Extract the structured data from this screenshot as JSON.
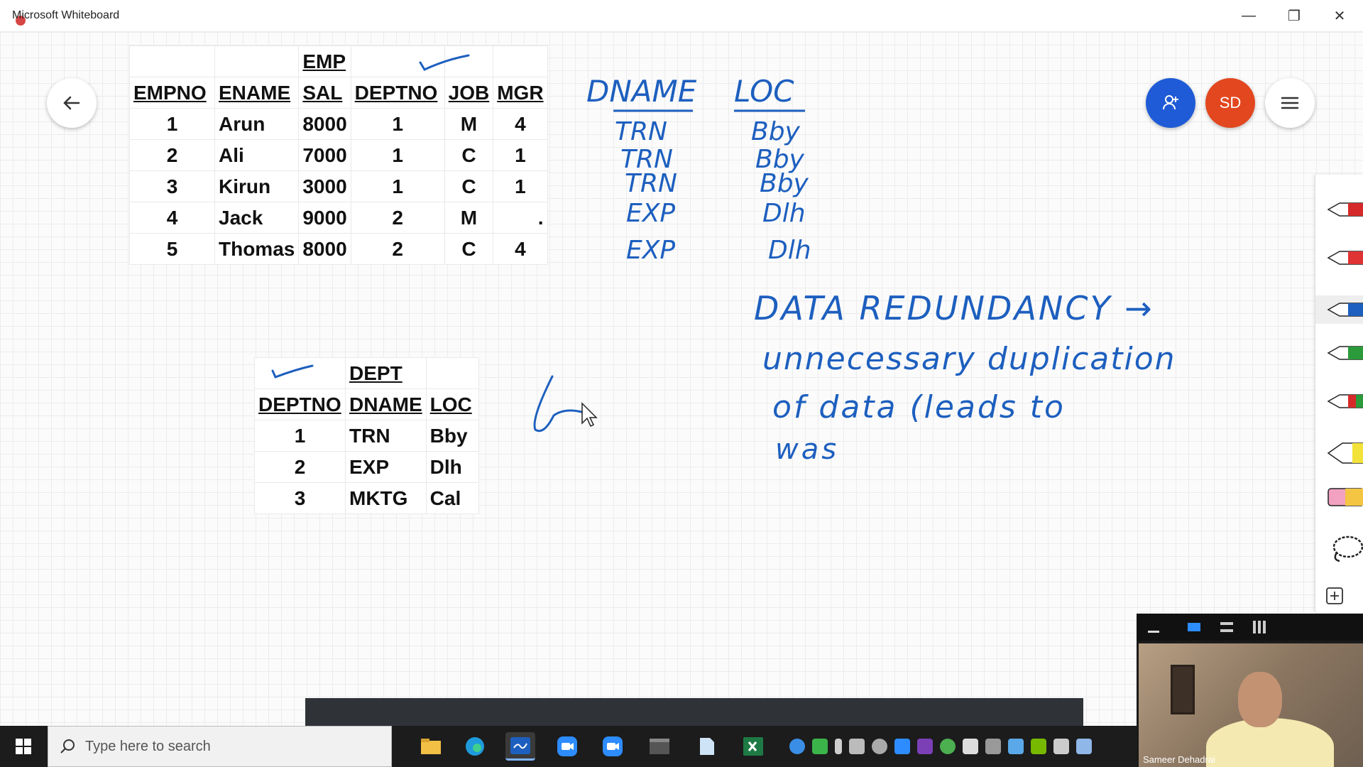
{
  "window": {
    "title": "Microsoft Whiteboard",
    "controls": {
      "minimize": "—",
      "restore": "❐",
      "close": "✕"
    }
  },
  "header": {
    "avatar_initials": "SD"
  },
  "emp_table": {
    "title": "EMP",
    "headers": [
      "EMPNO",
      "ENAME",
      "SAL",
      "DEPTNO",
      "JOB",
      "MGR"
    ],
    "rows": [
      [
        "1",
        "Arun",
        "8000",
        "1",
        "M",
        "4"
      ],
      [
        "2",
        "Ali",
        "7000",
        "1",
        "C",
        "1"
      ],
      [
        "3",
        "Kirun",
        "3000",
        "1",
        "C",
        "1"
      ],
      [
        "4",
        "Jack",
        "9000",
        "2",
        "M",
        "."
      ],
      [
        "5",
        "Thomas",
        "8000",
        "2",
        "C",
        "4"
      ]
    ]
  },
  "dept_table": {
    "title": "DEPT",
    "headers": [
      "DEPTNO",
      "DNAME",
      "LOC"
    ],
    "rows": [
      [
        "1",
        "TRN",
        "Bby"
      ],
      [
        "2",
        "EXP",
        "Dlh"
      ],
      [
        "3",
        "MKTG",
        "Cal"
      ]
    ]
  },
  "handwriting": {
    "col_header_1": "DNAME",
    "col_header_2": "LOC",
    "col1_values": [
      "TRN",
      "TRN",
      "TRN",
      "EXP",
      "EXP"
    ],
    "col2_values": [
      "Bby",
      "Bby",
      "Bby",
      "Dlh",
      "Dlh"
    ],
    "line1": "DATA REDUNDANCY →",
    "line2": "unnecessary duplication",
    "line3": "of data (leads to",
    "line4": "was",
    "ink_color": "#1d5fbf"
  },
  "pen_tray": {
    "pens": [
      "red-pen",
      "red-pen",
      "blue-pen",
      "green-pen",
      "green-red-pen",
      "highlighter",
      "eraser",
      "lasso",
      "add"
    ]
  },
  "taskbar": {
    "search_placeholder": "Type here to search"
  },
  "video": {
    "participant_name": "Sameer Dehadrai"
  }
}
